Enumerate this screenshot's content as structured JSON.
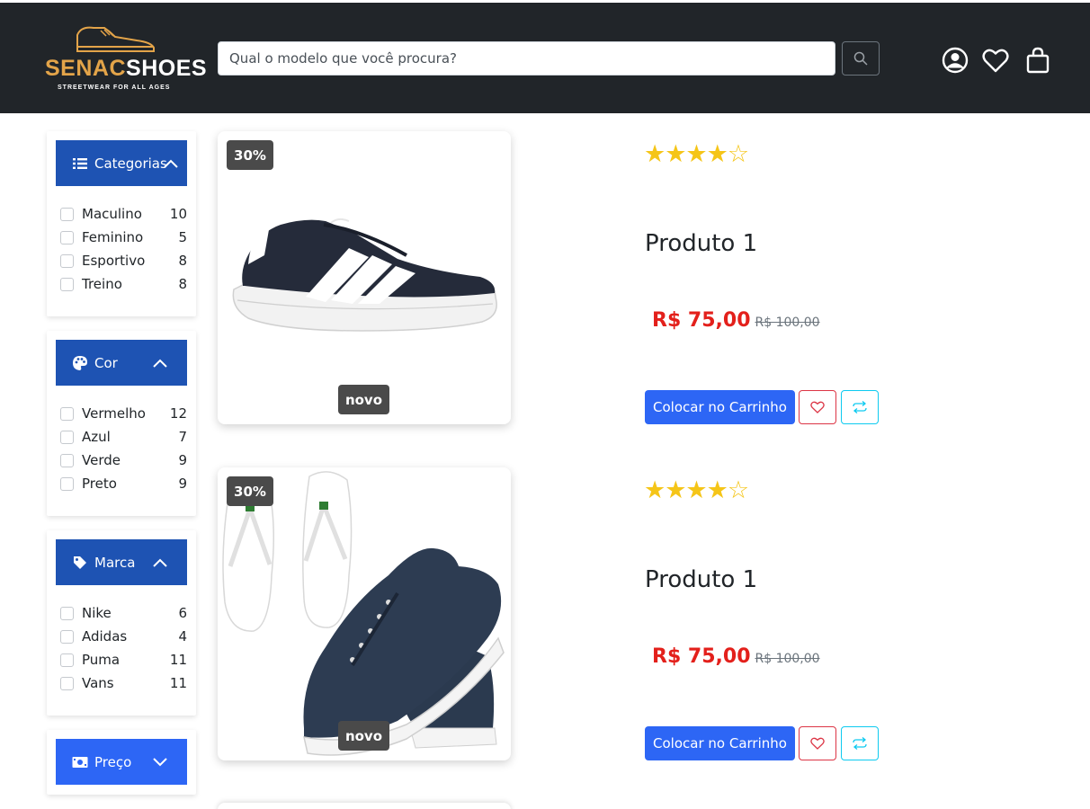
{
  "brand": {
    "name_part1": "SENAC",
    "name_part2": "SHOES",
    "tagline": "STREETWEAR FOR ALL AGES",
    "accent_color": "#e3a449"
  },
  "header": {
    "search_placeholder": "Qual o modelo que você procura?",
    "icons": [
      "search-icon",
      "user-icon",
      "heart-icon",
      "shopping-bag-icon"
    ]
  },
  "filters": [
    {
      "title": "Categorias",
      "icon": "list-icon",
      "expanded": true,
      "items": [
        {
          "label": "Maculino",
          "count": "10"
        },
        {
          "label": "Feminino",
          "count": "5"
        },
        {
          "label": "Esportivo",
          "count": "8"
        },
        {
          "label": "Treino",
          "count": "8"
        }
      ]
    },
    {
      "title": "Cor",
      "icon": "palette-icon",
      "expanded": true,
      "items": [
        {
          "label": "Vermelho",
          "count": "12"
        },
        {
          "label": "Azul",
          "count": "7"
        },
        {
          "label": "Verde",
          "count": "9"
        },
        {
          "label": "Preto",
          "count": "9"
        }
      ]
    },
    {
      "title": "Marca",
      "icon": "tag-icon",
      "expanded": true,
      "items": [
        {
          "label": "Nike",
          "count": "6"
        },
        {
          "label": "Adidas",
          "count": "4"
        },
        {
          "label": "Puma",
          "count": "11"
        },
        {
          "label": "Vans",
          "count": "11"
        }
      ]
    },
    {
      "title": "Preço",
      "icon": "money-icon",
      "expanded": false,
      "items": []
    }
  ],
  "products": [
    {
      "discount_badge": "30%",
      "new_badge": "novo",
      "rating": 4,
      "rating_max": 5,
      "stars_text": "★★★★☆",
      "name": "Produto 1",
      "price": "R$ 75,00",
      "old_price": "R$ 100,00",
      "cart_label": "Colocar no Carrinho",
      "image": "sneaker-image"
    },
    {
      "discount_badge": "30%",
      "new_badge": "novo",
      "rating": 4,
      "rating_max": 5,
      "stars_text": "★★★★☆",
      "name": "Produto 1",
      "price": "R$ 75,00",
      "old_price": "R$ 100,00",
      "cart_label": "Colocar no Carrinho",
      "image": "sandals-and-sneaker-image"
    }
  ],
  "colors": {
    "header_bg": "#212529",
    "filter_head_bg": "#1e53b3",
    "price_red": "#e3201b",
    "cart_button_blue": "#2d66f5",
    "star_gold": "#f5c518"
  }
}
